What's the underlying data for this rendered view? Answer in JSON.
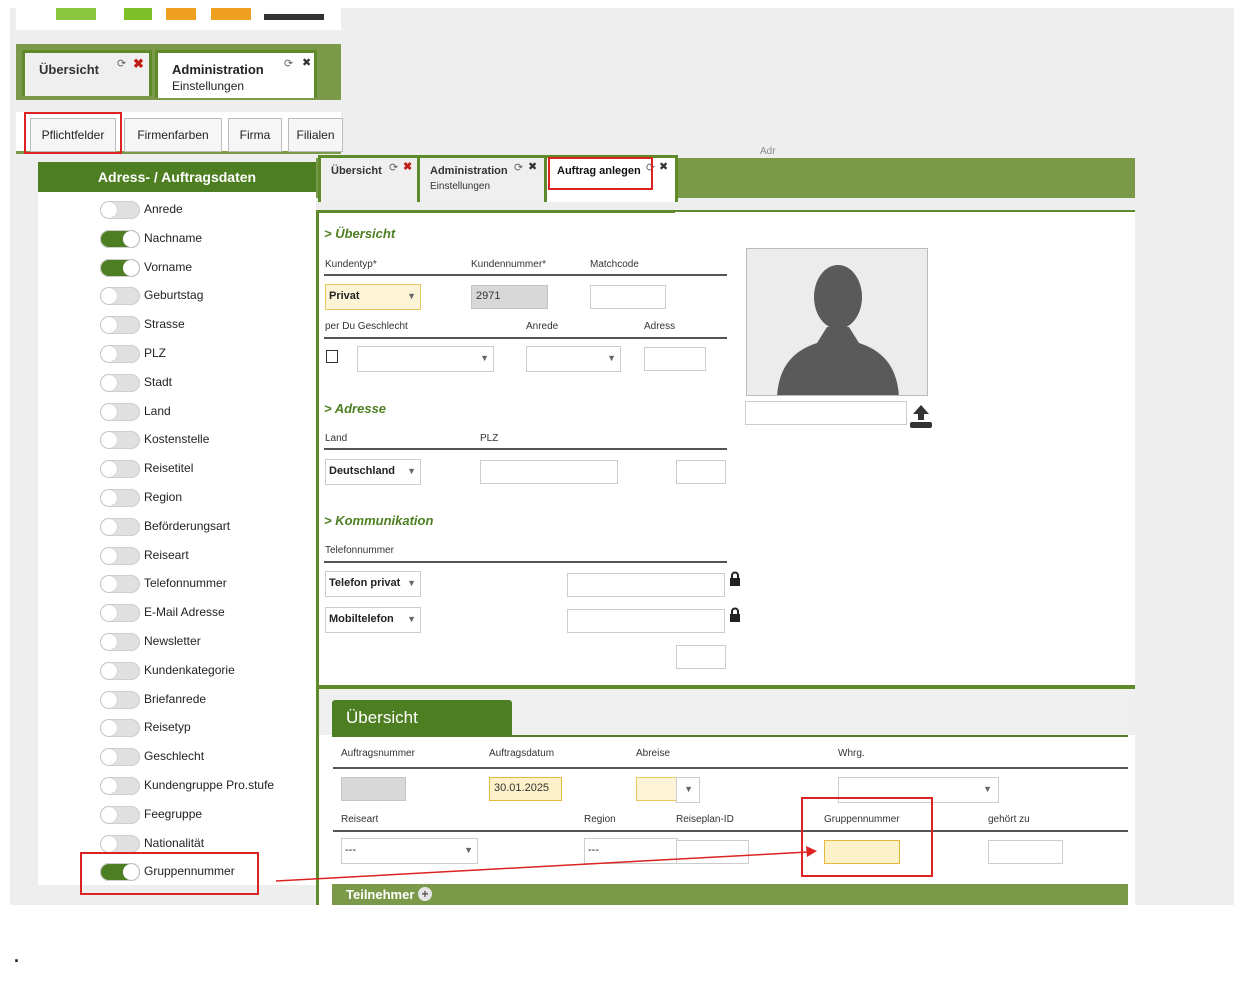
{
  "left": {
    "tabs": [
      {
        "label": "Übersicht"
      },
      {
        "label": "Administration",
        "sub": "Einstellungen"
      }
    ],
    "subtabs": [
      "Pflichtfelder",
      "Firmenfarben",
      "Firma",
      "Filialen"
    ],
    "panel_title": "Adress- / Auftragsdaten",
    "fields": [
      {
        "label": "Anrede",
        "on": false
      },
      {
        "label": "Nachname",
        "on": true
      },
      {
        "label": "Vorname",
        "on": true
      },
      {
        "label": "Geburtstag",
        "on": false
      },
      {
        "label": "Strasse",
        "on": false
      },
      {
        "label": "PLZ",
        "on": false
      },
      {
        "label": "Stadt",
        "on": false
      },
      {
        "label": "Land",
        "on": false
      },
      {
        "label": "Kostenstelle",
        "on": false
      },
      {
        "label": "Reisetitel",
        "on": false
      },
      {
        "label": "Region",
        "on": false
      },
      {
        "label": "Beförderungsart",
        "on": false
      },
      {
        "label": "Reiseart",
        "on": false
      },
      {
        "label": "Telefonnummer",
        "on": false
      },
      {
        "label": "E-Mail Adresse",
        "on": false
      },
      {
        "label": "Newsletter",
        "on": false
      },
      {
        "label": "Kundenkategorie",
        "on": false
      },
      {
        "label": "Briefanrede",
        "on": false
      },
      {
        "label": "Reisetyp",
        "on": false
      },
      {
        "label": "Geschlecht",
        "on": false
      },
      {
        "label": "Kundengruppe Pro.stufe",
        "on": false
      },
      {
        "label": "Feegruppe",
        "on": false
      },
      {
        "label": "Nationalität",
        "on": false
      },
      {
        "label": "Gruppennummer",
        "on": true
      }
    ]
  },
  "right": {
    "tabs": [
      {
        "label": "Übersicht"
      },
      {
        "label": "Administration",
        "sub": "Einstellungen"
      },
      {
        "label": "Auftrag anlegen"
      }
    ],
    "faded_text": "Adr",
    "uebersicht": {
      "title": "> Übersicht",
      "kundentyp_label": "Kundentyp*",
      "kundennummer_label": "Kundennummer*",
      "matchcode_label": "Matchcode",
      "kundentyp_value": "Privat",
      "kundennummer_value": "2971",
      "perdu_label": "per Du Geschlecht",
      "anrede_label": "Anrede",
      "adress_label": "Adress"
    },
    "adresse": {
      "title": "> Adresse",
      "land_label": "Land",
      "plz_label": "PLZ",
      "land_value": "Deutschland"
    },
    "kommunikation": {
      "title": "> Kommunikation",
      "telefon_label": "Telefonnummer",
      "phone1": "Telefon privat",
      "phone2": "Mobiltelefon"
    },
    "order": {
      "tab": "Übersicht",
      "auftragsnummer_label": "Auftragsnummer",
      "auftragsdatum_label": "Auftragsdatum",
      "abreise_label": "Abreise",
      "whrg_label": "Whrg.",
      "auftragsdatum_value": "30.01.2025",
      "reiseart_label": "Reiseart",
      "region_label": "Region",
      "reiseplan_label": "Reiseplan-ID",
      "gruppennummer_label": "Gruppennummer",
      "gehoert_label": "gehört zu",
      "reiseart_value": "---",
      "region_value": "---",
      "teilnehmer": "Teilnehmer"
    }
  },
  "caption": "."
}
